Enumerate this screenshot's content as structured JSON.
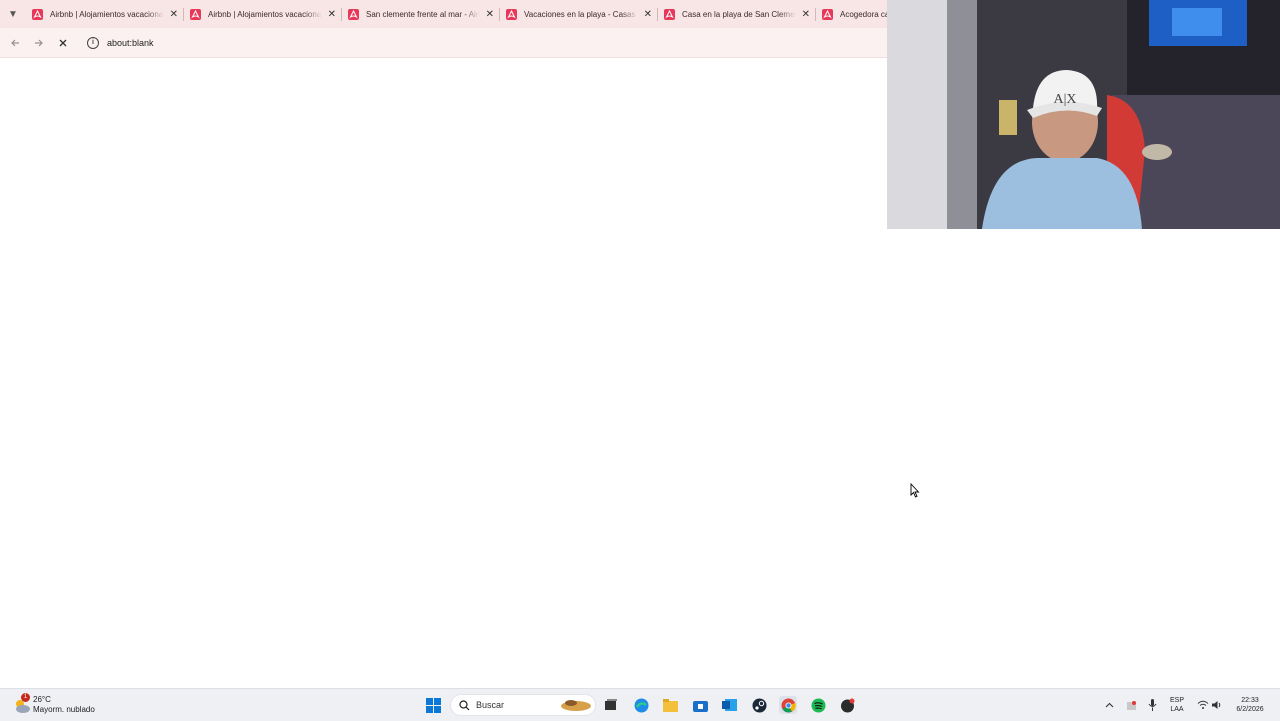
{
  "browser": {
    "tabs": [
      {
        "title": "Airbnb | Alojamientos vacacionales"
      },
      {
        "title": "Airbnb | Alojamientos vacacionales"
      },
      {
        "title": "San clemente frente al mar - Airbnb"
      },
      {
        "title": "Vacaciones en la playa - Casas de"
      },
      {
        "title": "Casa en la playa de San Clemente"
      },
      {
        "title": "Acogedora casa"
      }
    ],
    "url": "about:blank",
    "brand_color": "#e8385a"
  },
  "taskbar": {
    "weather": {
      "temp": "26°C",
      "desc": "Mayorm. nublado",
      "badge": "1"
    },
    "search_placeholder": "Buscar",
    "language": {
      "lang": "ESP",
      "layout": "LAA"
    },
    "clock": {
      "time": "22:33",
      "date": "6/2/2026"
    }
  }
}
